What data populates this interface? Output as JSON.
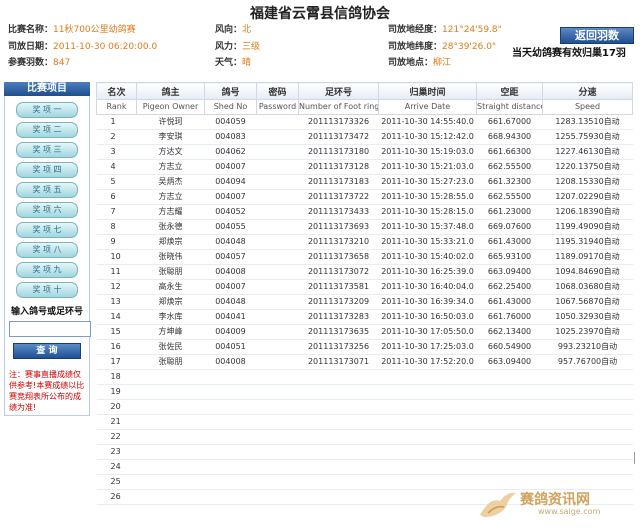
{
  "page_title": "福建省云霄县信鸽协会",
  "info": {
    "race_name_label": "比赛名称：",
    "race_name_value": "11秋700公里幼鸽赛",
    "wind_dir_label": "风向：",
    "wind_dir_value": "北",
    "release_lng_label": "司放地经度：",
    "release_lng_value": "121°24'59.8\"",
    "release_date_label": "司放日期：",
    "release_date_value": "2011-10-30 06:20:00.0",
    "wind_force_label": "风力：",
    "wind_force_value": "三级",
    "release_lat_label": "司放地纬度：",
    "release_lat_value": "28°39'26.0\"",
    "count_label": "参赛羽数：",
    "count_value": "847",
    "weather_label": "天气：",
    "weather_value": "晴",
    "release_place_label": "司放地点：",
    "release_place_value": "柳江"
  },
  "back_button": "返回羽数",
  "banner_text": "当天幼鸽赛有效归巢17羽",
  "sidebar": {
    "heading": "比赛项目",
    "items": [
      "奖 项 一",
      "奖 项 二",
      "奖 项 三",
      "奖 项 四",
      "奖 项 五",
      "奖 项 六",
      "奖 项 七",
      "奖 项 八",
      "奖 项 九",
      "奖 项 十"
    ],
    "input_label": "输入鸽号或足环号",
    "query_button": "查 询",
    "note": "注：赛事直播成绩仅供参考!本赛成绩以比赛竞翔表所公布的成绩为准!"
  },
  "table": {
    "headers": [
      "名次",
      "鸽主",
      "鸽号",
      "密码",
      "足环号",
      "归巢时间",
      "空距",
      "分速"
    ],
    "subheaders": [
      "Rank",
      "Pigeon Owner",
      "Shed No",
      "Password",
      "Number of Foot ring",
      "Arrive Date",
      "Straight distance",
      "Speed"
    ],
    "rows": [
      [
        "1",
        "许悦珂",
        "004059",
        "",
        "201113173326",
        "2011-10-30 14:55:40.0",
        "661.67000",
        "1283.13510自动"
      ],
      [
        "2",
        "李安琪",
        "004083",
        "",
        "201113173472",
        "2011-10-30 15:12:42.0",
        "668.94300",
        "1255.75930自动"
      ],
      [
        "3",
        "方达文",
        "004062",
        "",
        "201113173180",
        "2011-10-30 15:19:03.0",
        "661.66300",
        "1227.46130自动"
      ],
      [
        "4",
        "方志立",
        "004007",
        "",
        "201113173128",
        "2011-10-30 15:21:03.0",
        "662.55500",
        "1220.13750自动"
      ],
      [
        "5",
        "吴炳杰",
        "004094",
        "",
        "201113173183",
        "2011-10-30 15:27:23.0",
        "661.32300",
        "1208.15330自动"
      ],
      [
        "6",
        "方志立",
        "004007",
        "",
        "201113173722",
        "2011-10-30 15:28:55.0",
        "662.55500",
        "1207.02290自动"
      ],
      [
        "7",
        "方志耀",
        "004052",
        "",
        "201113173433",
        "2011-10-30 15:28:15.0",
        "661.23000",
        "1206.18390自动"
      ],
      [
        "8",
        "张永德",
        "004055",
        "",
        "201113173693",
        "2011-10-30 15:37:48.0",
        "669.07600",
        "1199.49090自动"
      ],
      [
        "9",
        "郑焕宗",
        "004048",
        "",
        "201113173210",
        "2011-10-30 15:33:21.0",
        "661.43000",
        "1195.31940自动"
      ],
      [
        "10",
        "张晓伟",
        "004057",
        "",
        "201113173658",
        "2011-10-30 15:40:02.0",
        "665.93100",
        "1189.09170自动"
      ],
      [
        "11",
        "张聪朋",
        "004008",
        "",
        "201113173072",
        "2011-10-30 16:25:39.0",
        "663.09400",
        "1094.84690自动"
      ],
      [
        "12",
        "高永生",
        "004007",
        "",
        "201113173581",
        "2011-10-30 16:40:04.0",
        "662.25400",
        "1068.03680自动"
      ],
      [
        "13",
        "郑焕宗",
        "004048",
        "",
        "201113173209",
        "2011-10-30 16:39:34.0",
        "661.43000",
        "1067.56870自动"
      ],
      [
        "14",
        "李水库",
        "004041",
        "",
        "201113173283",
        "2011-10-30 16:50:03.0",
        "661.76000",
        "1050.32930自动"
      ],
      [
        "15",
        "方坤峰",
        "004009",
        "",
        "201113173635",
        "2011-10-30 17:05:50.0",
        "662.13400",
        "1025.23970自动"
      ],
      [
        "16",
        "张佐民",
        "004051",
        "",
        "201113173256",
        "2011-10-30 17:25:03.0",
        "660.54900",
        "993.23210自动"
      ],
      [
        "17",
        "张聪朋",
        "004008",
        "",
        "201113173071",
        "2011-10-30 17:52:20.0",
        "663.09400",
        "957.76700自动"
      ],
      [
        "18",
        "",
        "",
        "",
        "",
        "",
        "",
        ""
      ],
      [
        "19",
        "",
        "",
        "",
        "",
        "",
        "",
        ""
      ],
      [
        "20",
        "",
        "",
        "",
        "",
        "",
        "",
        ""
      ],
      [
        "21",
        "",
        "",
        "",
        "",
        "",
        "",
        ""
      ],
      [
        "22",
        "",
        "",
        "",
        "",
        "",
        "",
        ""
      ],
      [
        "23",
        "",
        "",
        "",
        "",
        "",
        "",
        ""
      ],
      [
        "24",
        "",
        "",
        "",
        "",
        "",
        "",
        ""
      ],
      [
        "25",
        "",
        "",
        "",
        "",
        "",
        "",
        ""
      ],
      [
        "26",
        "",
        "",
        "",
        "",
        "",
        "",
        ""
      ]
    ]
  },
  "watermark": {
    "text": "赛鸽资讯网",
    "url": "www.saige.com"
  }
}
